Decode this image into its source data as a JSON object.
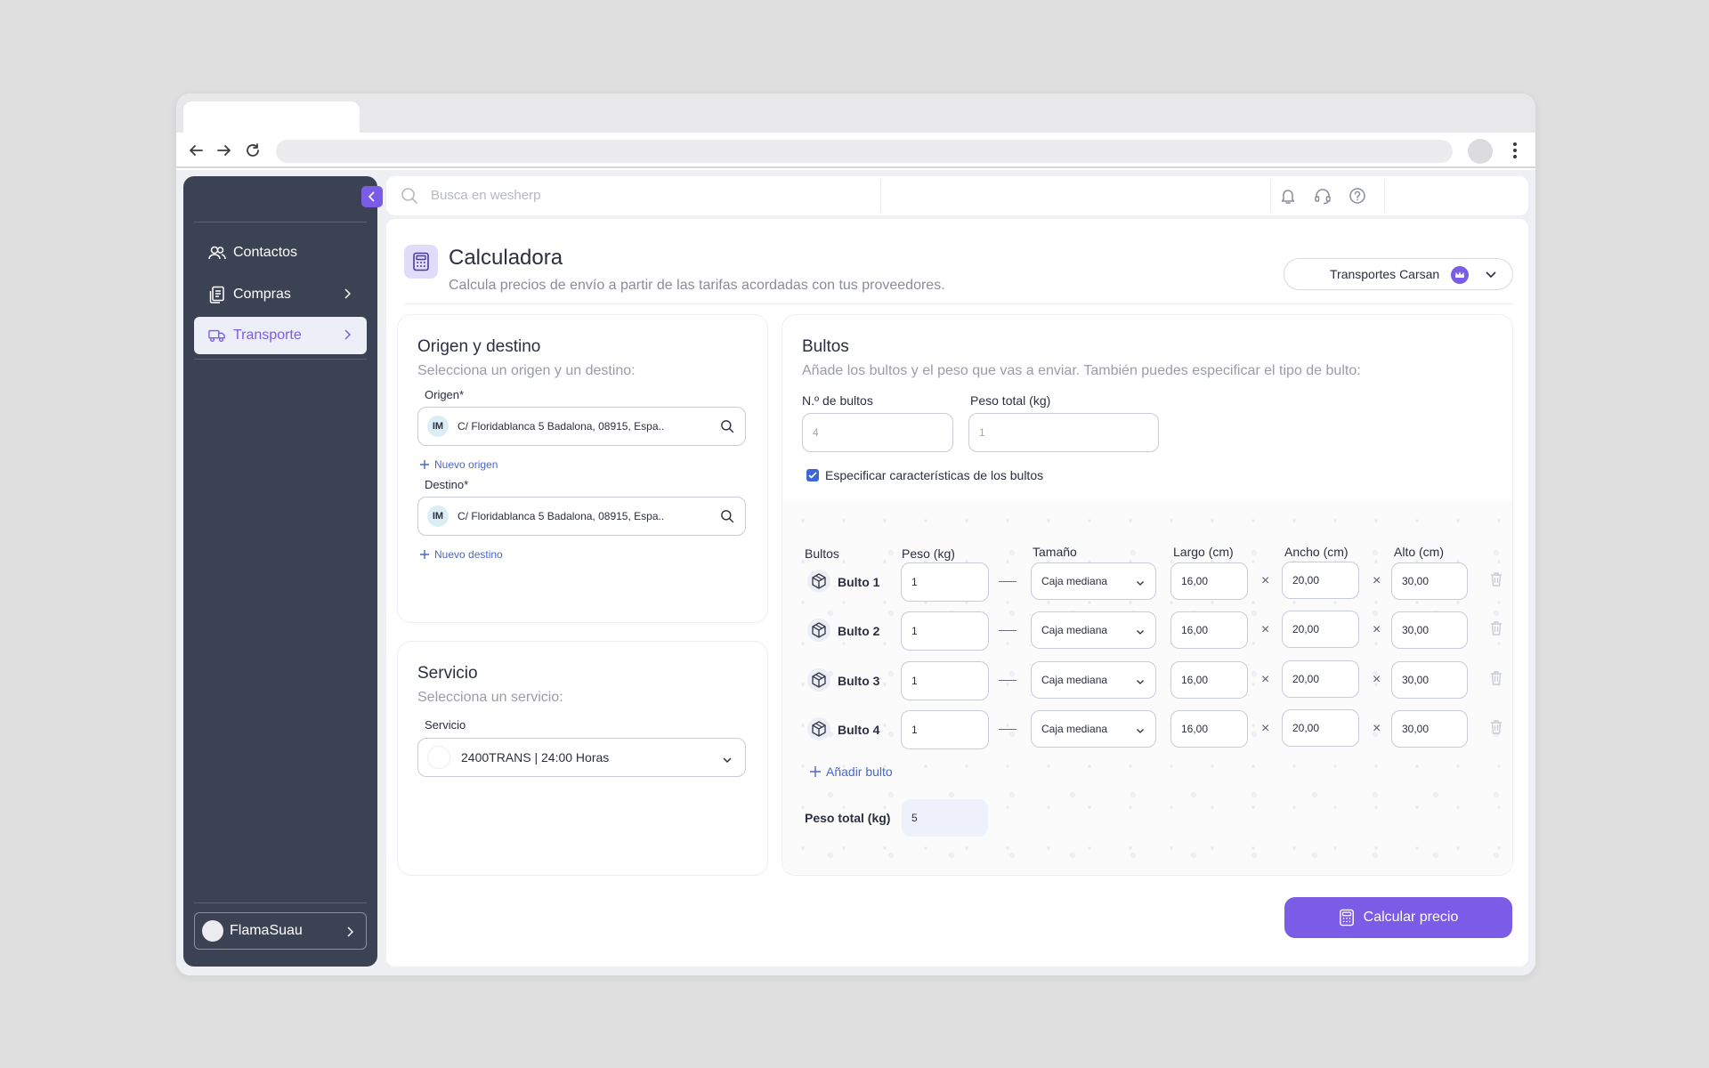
{
  "browser": {
    "tab_title": "",
    "url": ""
  },
  "sidebar": {
    "items": [
      {
        "label": "Contactos",
        "icon": "users-icon"
      },
      {
        "label": "Compras",
        "icon": "receipt-icon"
      },
      {
        "label": "Transporte",
        "icon": "truck-icon",
        "active": true
      }
    ],
    "user": "FlamaSuau"
  },
  "topbar": {
    "search_placeholder": "Busca en wesherp"
  },
  "page": {
    "title": "Calculadora",
    "subtitle": "Calcula precios de envío a partir de las tarifas acordadas con tus proveedores.",
    "provider": "Transportes Carsan"
  },
  "origin_card": {
    "title": "Origen y destino",
    "subtitle": "Selecciona un origen y un destino:",
    "origin_label": "Origen*",
    "origin_badge": "IM",
    "origin_value": "C/ Floridablanca 5 Badalona, 08915, Espa..",
    "new_origin": "Nuevo origen",
    "dest_label": "Destino*",
    "dest_badge": "IM",
    "dest_value": "C/ Floridablanca 5 Badalona, 08915, Espa..",
    "new_dest": "Nuevo destino"
  },
  "service_card": {
    "title": "Servicio",
    "subtitle": "Selecciona un servicio:",
    "label": "Servicio",
    "value": "2400TRANS | 24:00 Horas"
  },
  "bultos_card": {
    "title": "Bultos",
    "subtitle": "Añade los bultos y el peso que vas a enviar. También puedes especificar el tipo de bulto:",
    "num_label": "N.º de bultos",
    "num_value": "4",
    "weight_label": "Peso total (kg)",
    "weight_value": "1",
    "checkbox_label": "Especificar características de los bultos",
    "checkbox_checked": true,
    "headers": {
      "bultos": "Bultos",
      "peso": "Peso (kg)",
      "tamano": "Tamaño",
      "largo": "Largo (cm)",
      "ancho": "Ancho (cm)",
      "alto": "Alto (cm)"
    },
    "rows": [
      {
        "name": "Bulto 1",
        "peso": "1",
        "tamano": "Caja mediana",
        "largo": "16,00",
        "ancho": "20,00",
        "alto": "30,00"
      },
      {
        "name": "Bulto 2",
        "peso": "1",
        "tamano": "Caja mediana",
        "largo": "16,00",
        "ancho": "20,00",
        "alto": "30,00"
      },
      {
        "name": "Bulto 3",
        "peso": "1",
        "tamano": "Caja mediana",
        "largo": "16,00",
        "ancho": "20,00",
        "alto": "30,00"
      },
      {
        "name": "Bulto 4",
        "peso": "1",
        "tamano": "Caja mediana",
        "largo": "16,00",
        "ancho": "20,00",
        "alto": "30,00"
      }
    ],
    "add_label": "Añadir bulto",
    "total_label": "Peso total (kg)",
    "total_value": "5"
  },
  "actions": {
    "calc_label": "Calcular precio"
  },
  "colors": {
    "accent": "#7b5ce6",
    "sidebar": "#3b4253",
    "link": "#4a67c9"
  }
}
